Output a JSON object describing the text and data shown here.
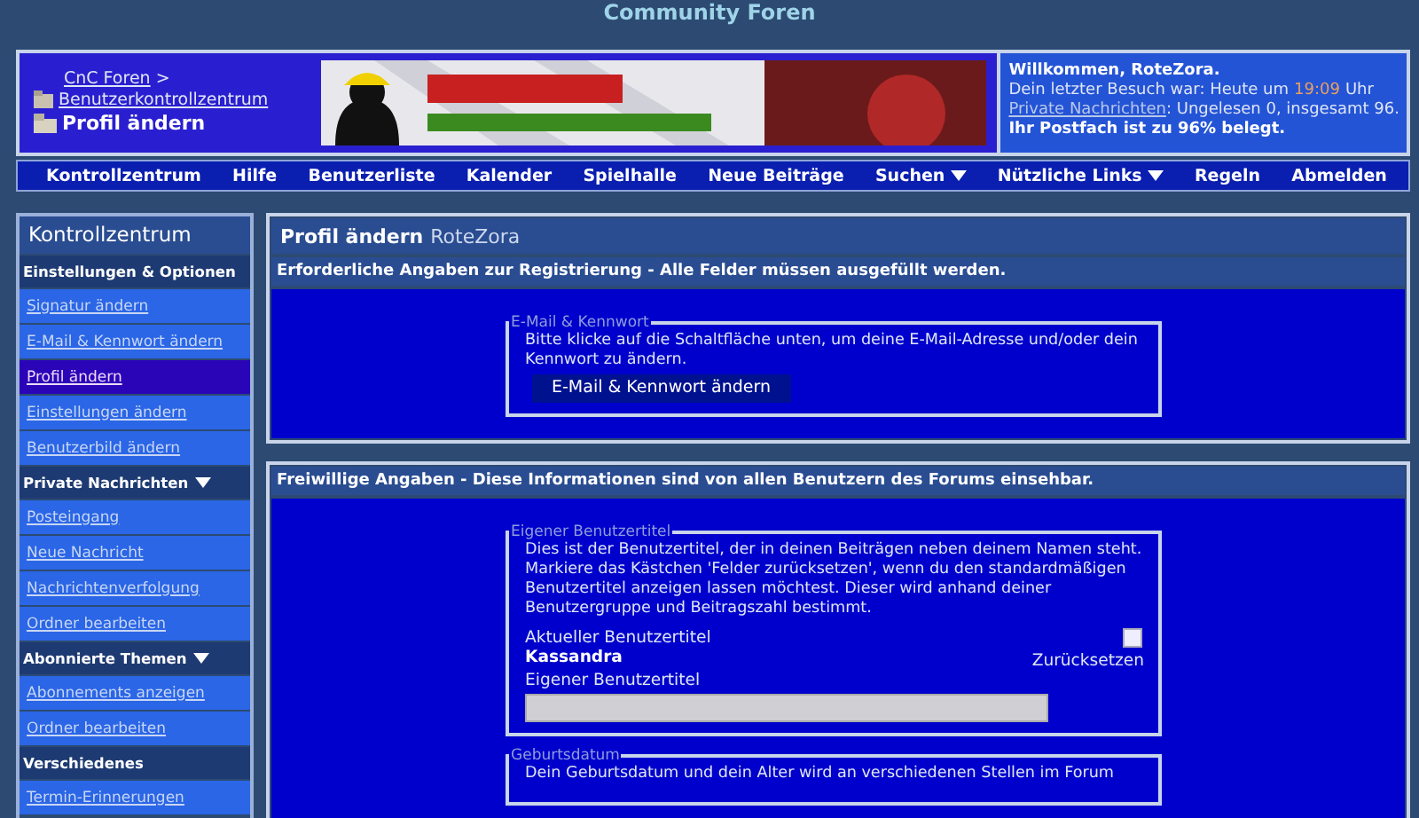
{
  "logo": {
    "text": "Community Foren"
  },
  "breadcrumb": {
    "links": [
      "CnC Foren",
      "Benutzerkontrollzentrum"
    ],
    "separator": ">",
    "current": "Profil ändern"
  },
  "welcome": {
    "title": "Willkommen, RoteZora.",
    "visit_prefix": "Dein letzter Besuch war: Heute um",
    "visit_time": "19:09",
    "visit_suffix": "Uhr",
    "pm_link": "Private Nachrichten",
    "pm_text": ": Ungelesen 0, insgesamt 96.",
    "mailbox": "Ihr Postfach ist zu 96% belegt."
  },
  "navbar": [
    {
      "label": "Kontrollzentrum",
      "dropdown": false
    },
    {
      "label": "Hilfe",
      "dropdown": false
    },
    {
      "label": "Benutzerliste",
      "dropdown": false
    },
    {
      "label": "Kalender",
      "dropdown": false
    },
    {
      "label": "Spielhalle",
      "dropdown": false
    },
    {
      "label": "Neue Beiträge",
      "dropdown": false
    },
    {
      "label": "Suchen",
      "dropdown": true
    },
    {
      "label": "Nützliche Links",
      "dropdown": true
    },
    {
      "label": "Regeln",
      "dropdown": false
    },
    {
      "label": "Abmelden",
      "dropdown": false
    }
  ],
  "sidebar": {
    "title": "Kontrollzentrum",
    "sections": [
      {
        "title": "Einstellungen & Optionen",
        "collapsible": false,
        "items": [
          {
            "label": "Signatur ändern",
            "selected": false
          },
          {
            "label": "E-Mail & Kennwort ändern",
            "selected": false
          },
          {
            "label": "Profil ändern",
            "selected": true
          },
          {
            "label": "Einstellungen ändern",
            "selected": false
          },
          {
            "label": "Benutzerbild ändern",
            "selected": false
          }
        ]
      },
      {
        "title": "Private Nachrichten",
        "collapsible": true,
        "items": [
          {
            "label": "Posteingang",
            "selected": false
          },
          {
            "label": "Neue Nachricht",
            "selected": false
          },
          {
            "label": "Nachrichtenverfolgung",
            "selected": false
          },
          {
            "label": "Ordner bearbeiten",
            "selected": false
          }
        ]
      },
      {
        "title": "Abonnierte Themen",
        "collapsible": true,
        "items": [
          {
            "label": "Abonnements anzeigen",
            "selected": false
          },
          {
            "label": "Ordner bearbeiten",
            "selected": false
          }
        ]
      },
      {
        "title": "Verschiedenes",
        "collapsible": false,
        "items": [
          {
            "label": "Termin-Erinnerungen",
            "selected": false
          }
        ]
      }
    ]
  },
  "page_title": {
    "title": "Profil ändern",
    "user": "RoteZora"
  },
  "required": {
    "heading": "Erforderliche Angaben zur Registrierung - Alle Felder müssen ausgefüllt werden.",
    "fieldset": {
      "legend": "E-Mail & Kennwort",
      "text": "Bitte klicke auf die Schaltfläche unten, um deine E-Mail-Adresse und/oder dein Kennwort zu ändern.",
      "button": "E-Mail & Kennwort ändern"
    }
  },
  "optional": {
    "heading": "Freiwillige Angaben - Diese Informationen sind von allen Benutzern des Forums einsehbar.",
    "title_fieldset": {
      "legend": "Eigener Benutzertitel",
      "text": "Dies ist der Benutzertitel, der in deinen Beiträgen neben deinem Namen steht. Markiere das Kästchen 'Felder zurücksetzen', wenn du den standardmäßigen Benutzertitel anzeigen lassen möchtest. Dieser wird anhand deiner Benutzergruppe und Beitragszahl bestimmt.",
      "current_label": "Aktueller Benutzertitel",
      "current_value": "Kassandra",
      "reset_label": "Zurücksetzen",
      "reset_checked": false,
      "custom_label": "Eigener Benutzertitel"
    },
    "birthday_fieldset": {
      "legend": "Geburtsdatum",
      "text": "Dein Geburtsdatum und dein Alter wird an verschiedenen Stellen im Forum"
    }
  }
}
